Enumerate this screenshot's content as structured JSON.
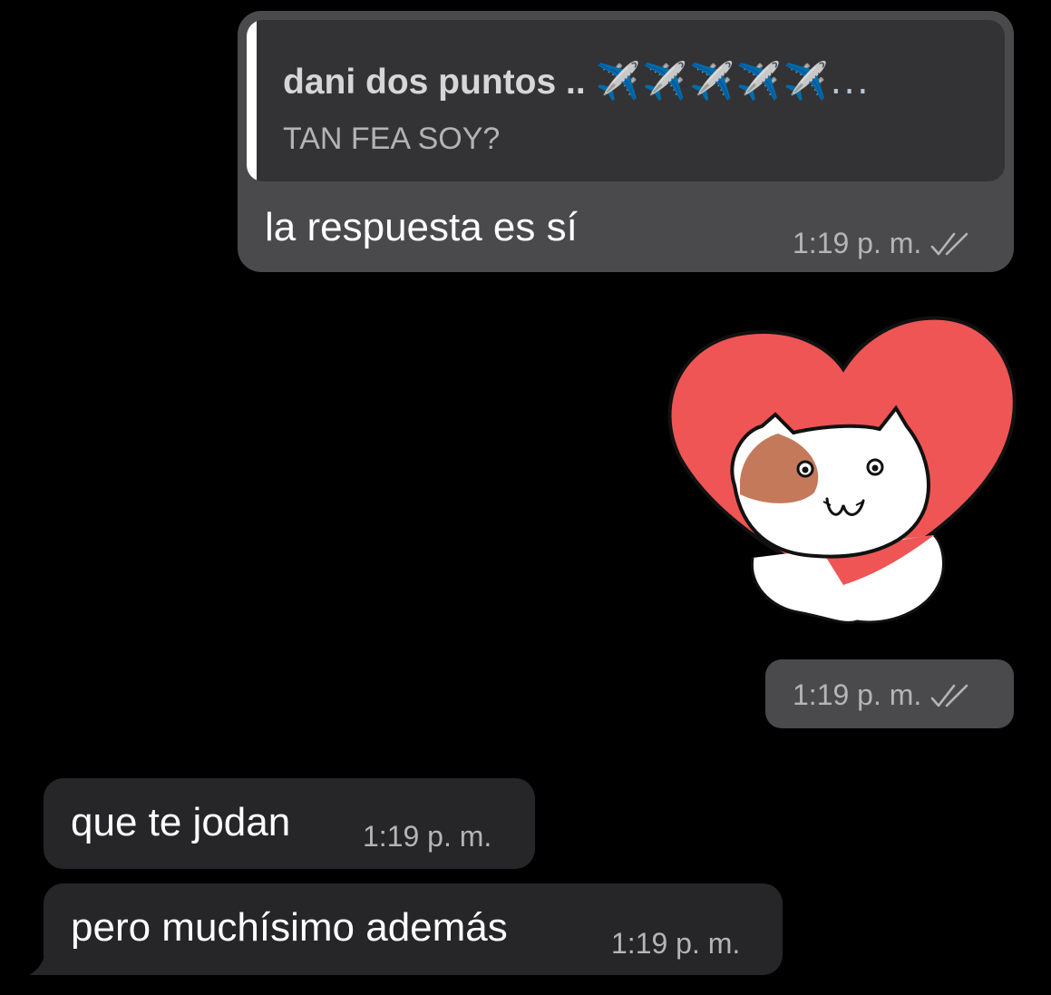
{
  "messages": {
    "outgoing_reply": {
      "quoted_author": "dani dos puntos .. ",
      "quoted_author_emoji": "✈️✈️✈️✈️✈️...",
      "quoted_text": "TAN FEA SOY?",
      "text": "la respuesta es sí",
      "time": "1:19 p. m.",
      "status_icon": "double-check-icon"
    },
    "outgoing_sticker": {
      "sticker": "cat-in-heart-sticker",
      "time": "1:19 p. m.",
      "status_icon": "double-check-icon"
    },
    "incoming": [
      {
        "text": "que te jodan",
        "time": "1:19 p. m."
      },
      {
        "text": "pero muchísimo además",
        "time": "1:19 p. m."
      }
    ]
  },
  "colors": {
    "background": "#000000",
    "outgoing_bubble": "#4a4a4c",
    "incoming_bubble": "#262628",
    "quote_box": "#333335",
    "heart": "#ef5555"
  }
}
